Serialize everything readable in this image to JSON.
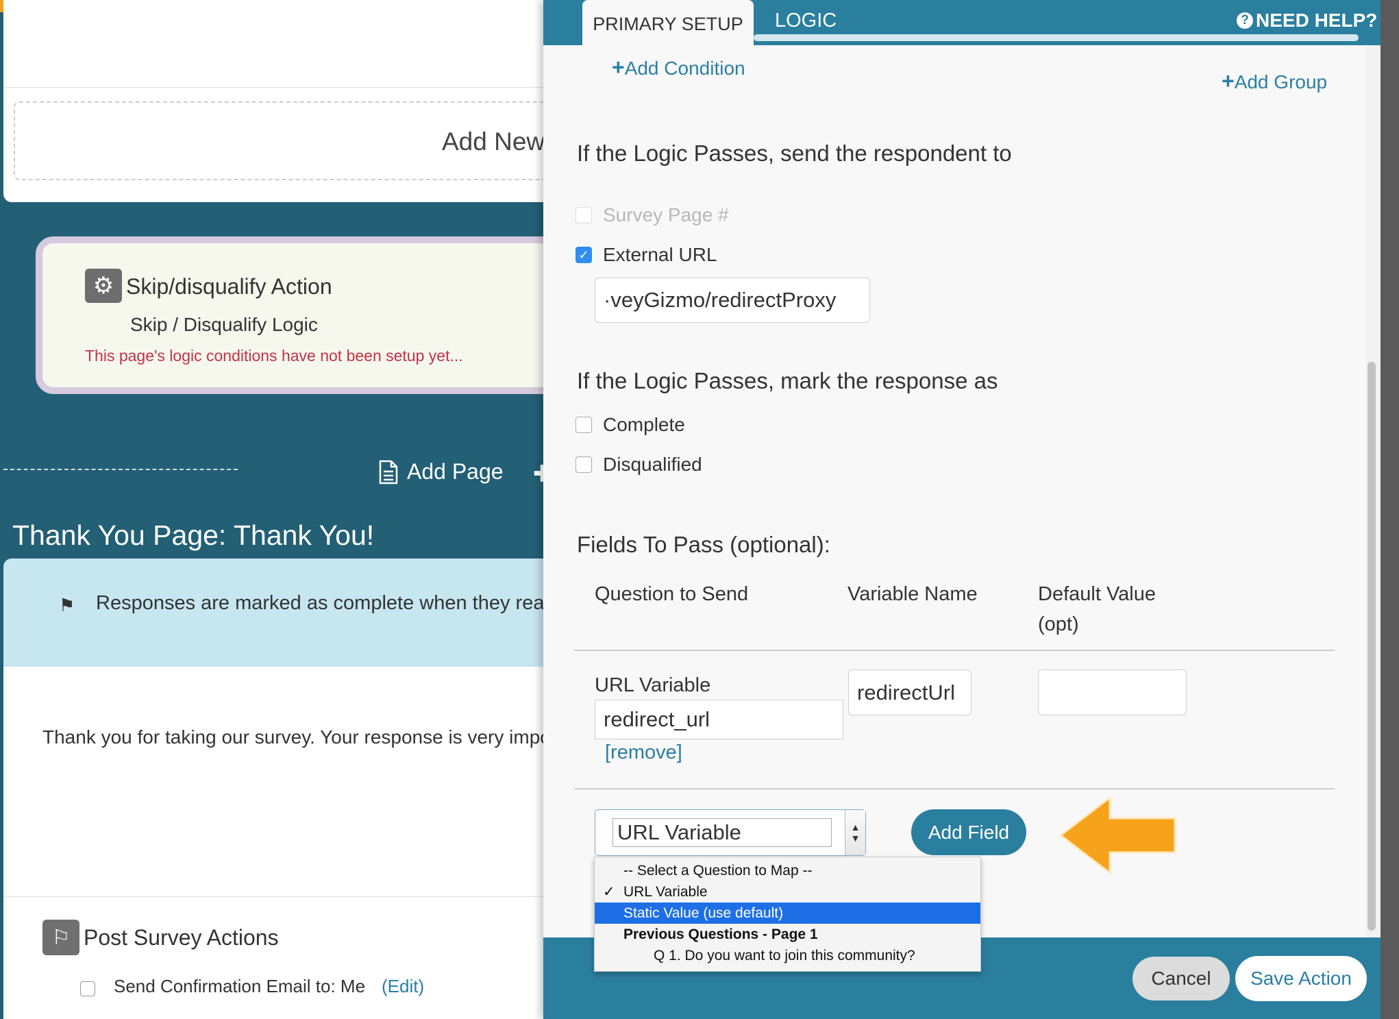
{
  "background": {
    "add_new_label": "Add New",
    "action_card": {
      "title": "Skip/disqualify Action",
      "subtitle": "Skip / Disqualify Logic",
      "warning": "This page's logic conditions have not been setup yet..."
    },
    "add_page_label": "Add Page",
    "thank_you_title": "Thank You Page: Thank You!",
    "info_text": "Responses are marked as complete when they reach",
    "thank_you_body": "Thank you for taking our survey. Your response is very impor",
    "post_survey_title": "Post Survey Actions",
    "confirmation_email_label": "Send Confirmation Email to: Me",
    "edit_link": "(Edit)"
  },
  "modal": {
    "tabs": [
      {
        "label": "PRIMARY SETUP",
        "active": true
      },
      {
        "label": "LOGIC",
        "active": false
      }
    ],
    "need_help": "NEED HELP?",
    "add_condition": "Add Condition",
    "add_group": "Add Group",
    "send_to": {
      "heading": "If the Logic Passes, send the respondent to",
      "options": [
        {
          "label": "Survey Page #",
          "checked": false,
          "disabled": true
        },
        {
          "label": "External URL",
          "checked": true,
          "disabled": false
        }
      ],
      "url_value": "·veyGizmo/redirectProxy"
    },
    "mark_as": {
      "heading": "If the Logic Passes, mark the response as",
      "options": [
        {
          "label": "Complete",
          "checked": false
        },
        {
          "label": "Disqualified",
          "checked": false
        }
      ]
    },
    "fields": {
      "heading": "Fields To Pass (optional):",
      "columns": [
        "Question to Send",
        "Variable Name",
        "Default Value (opt)"
      ],
      "row": {
        "question": "URL Variable",
        "question_value": "redirect_url",
        "variable_name": "redirectUrl",
        "default_value": "",
        "remove": "[remove]"
      },
      "select_value": "URL Variable",
      "add_field_button": "Add Field"
    },
    "dropdown_options": [
      {
        "label": "-- Select a Question to Map --"
      },
      {
        "label": "URL Variable",
        "checked": true
      },
      {
        "label": "Static Value (use default)",
        "highlighted": true
      },
      {
        "label": "Previous Questions - Page 1",
        "group": true
      },
      {
        "label": "Q 1. Do you want to join this community?"
      }
    ],
    "footer": {
      "cancel": "Cancel",
      "save": "Save Action"
    }
  },
  "colors": {
    "teal": "#2a7f9e",
    "link": "#2a7fa6",
    "warning": "#c4314b",
    "arrow": "#f7a21b",
    "highlight": "#1e6fe6"
  },
  "icons": [
    "gears-icon",
    "document-icon",
    "flag-icon",
    "question-circle-icon",
    "checkmark-icon",
    "chevron-icon",
    "arrow-left-icon"
  ]
}
